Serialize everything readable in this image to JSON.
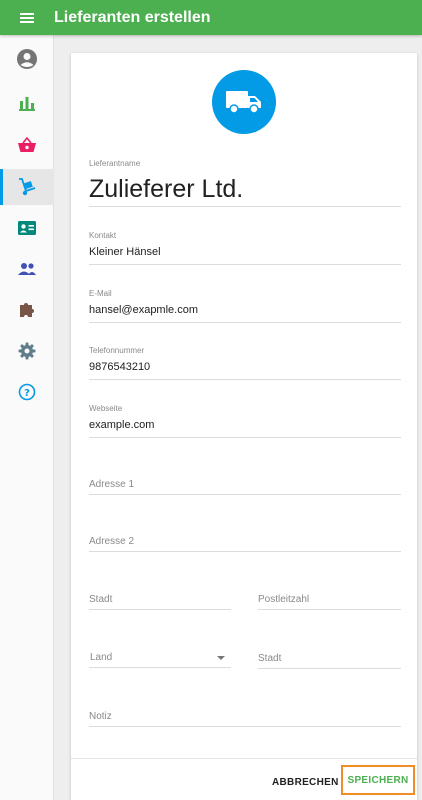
{
  "appbar": {
    "title": "Lieferanten erstellen",
    "menu_icon": "menu-icon"
  },
  "sidebar": {
    "items": [
      {
        "name": "account",
        "icon": "account-circle-icon",
        "color": "#757575"
      },
      {
        "name": "statistics",
        "icon": "bar-chart-icon",
        "color": "#4caf50"
      },
      {
        "name": "shop",
        "icon": "basket-icon",
        "color": "#e91e63"
      },
      {
        "name": "suppliers",
        "icon": "dolly-icon",
        "color": "#039be5",
        "active": true
      },
      {
        "name": "customers",
        "icon": "contact-card-icon",
        "color": "#00897b"
      },
      {
        "name": "users",
        "icon": "people-icon",
        "color": "#3f51b5"
      },
      {
        "name": "plugins",
        "icon": "puzzle-icon",
        "color": "#795548"
      },
      {
        "name": "settings",
        "icon": "gear-icon",
        "color": "#607d8b"
      },
      {
        "name": "help",
        "icon": "help-icon",
        "color": "#039be5"
      }
    ]
  },
  "form": {
    "avatar_icon": "truck-icon",
    "supplier_name": {
      "label": "Lieferantname",
      "value": "Zulieferer Ltd."
    },
    "contact": {
      "label": "Kontakt",
      "value": "Kleiner Hänsel"
    },
    "email": {
      "label": "E-Mail",
      "value": "hansel@exapmle.com"
    },
    "phone": {
      "label": "Telefonnummer",
      "value": "9876543210"
    },
    "website": {
      "label": "Webseite",
      "value": "example.com"
    },
    "address1": {
      "placeholder": "Adresse 1"
    },
    "address2": {
      "placeholder": "Adresse 2"
    },
    "city": {
      "placeholder": "Stadt"
    },
    "postal_code": {
      "placeholder": "Postleitzahl"
    },
    "country": {
      "placeholder": "Land"
    },
    "state": {
      "placeholder": "Stadt"
    },
    "notes": {
      "placeholder": "Notiz"
    }
  },
  "actions": {
    "cancel_label": "ABBRECHEN",
    "save_label": "SPEICHERN"
  },
  "colors": {
    "appbar": "#4caf50",
    "accent": "#039be5",
    "save_highlight": "#f28c28"
  }
}
